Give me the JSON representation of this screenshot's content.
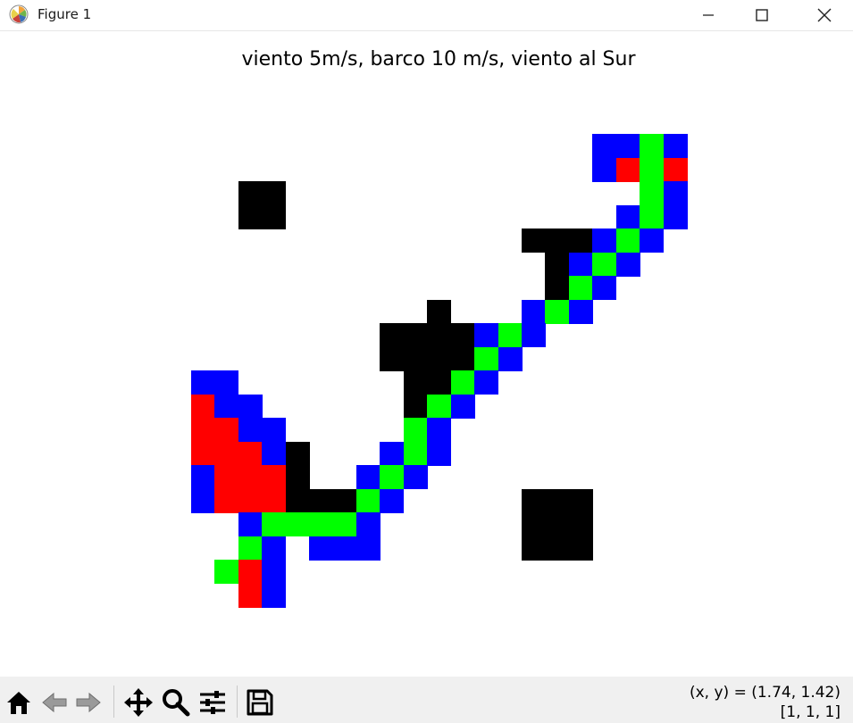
{
  "window": {
    "title": "Figure 1",
    "icon": "matplotlib-logo-icon",
    "controls": [
      "minimize-icon",
      "maximize-icon",
      "close-icon"
    ]
  },
  "figure": {
    "title": "viento 5m/s, barco 10 m/s, viento al Sur"
  },
  "grid_data": {
    "rows": 20,
    "cols": 21,
    "colors": {
      "B": "#0000ff",
      "G": "#00ff00",
      "R": "#ff0000",
      "K": "#000000",
      ".": "#ffffff"
    },
    "cells": [
      ".................BBGB",
      ".................BRGR",
      "..KK...............GB",
      "..KK..............BGB",
      "..............KKKBGB.",
      "...............KBGB..",
      "...............KGB...",
      "..........K...BGB....",
      "........KKKKBGB......",
      "........KKKKGB.......",
      "BB.......KKGB........",
      "RBB......KGB.........",
      "RRBB.....GB..........",
      "RRRBK...BGB..........",
      "BRRRK..BGB...........",
      "BRRRKKKGB.....KKK....",
      "..BGGGGB......KKK....",
      "..GB.BBB......KKK....",
      ".GRB.................",
      "..RB................."
    ]
  },
  "toolbar": {
    "tools": [
      {
        "id": "home",
        "icon": "home-icon"
      },
      {
        "id": "back",
        "icon": "back-arrow-icon"
      },
      {
        "id": "forward",
        "icon": "forward-arrow-icon"
      },
      {
        "id": "pan",
        "icon": "pan-move-icon"
      },
      {
        "id": "zoom",
        "icon": "zoom-magnifier-icon"
      },
      {
        "id": "configure",
        "icon": "configure-subplots-icon"
      },
      {
        "id": "save",
        "icon": "save-floppy-icon"
      }
    ],
    "coordinates": "(x, y) = (1.74, 1.42)",
    "pixel_value": "[1, 1, 1]"
  }
}
